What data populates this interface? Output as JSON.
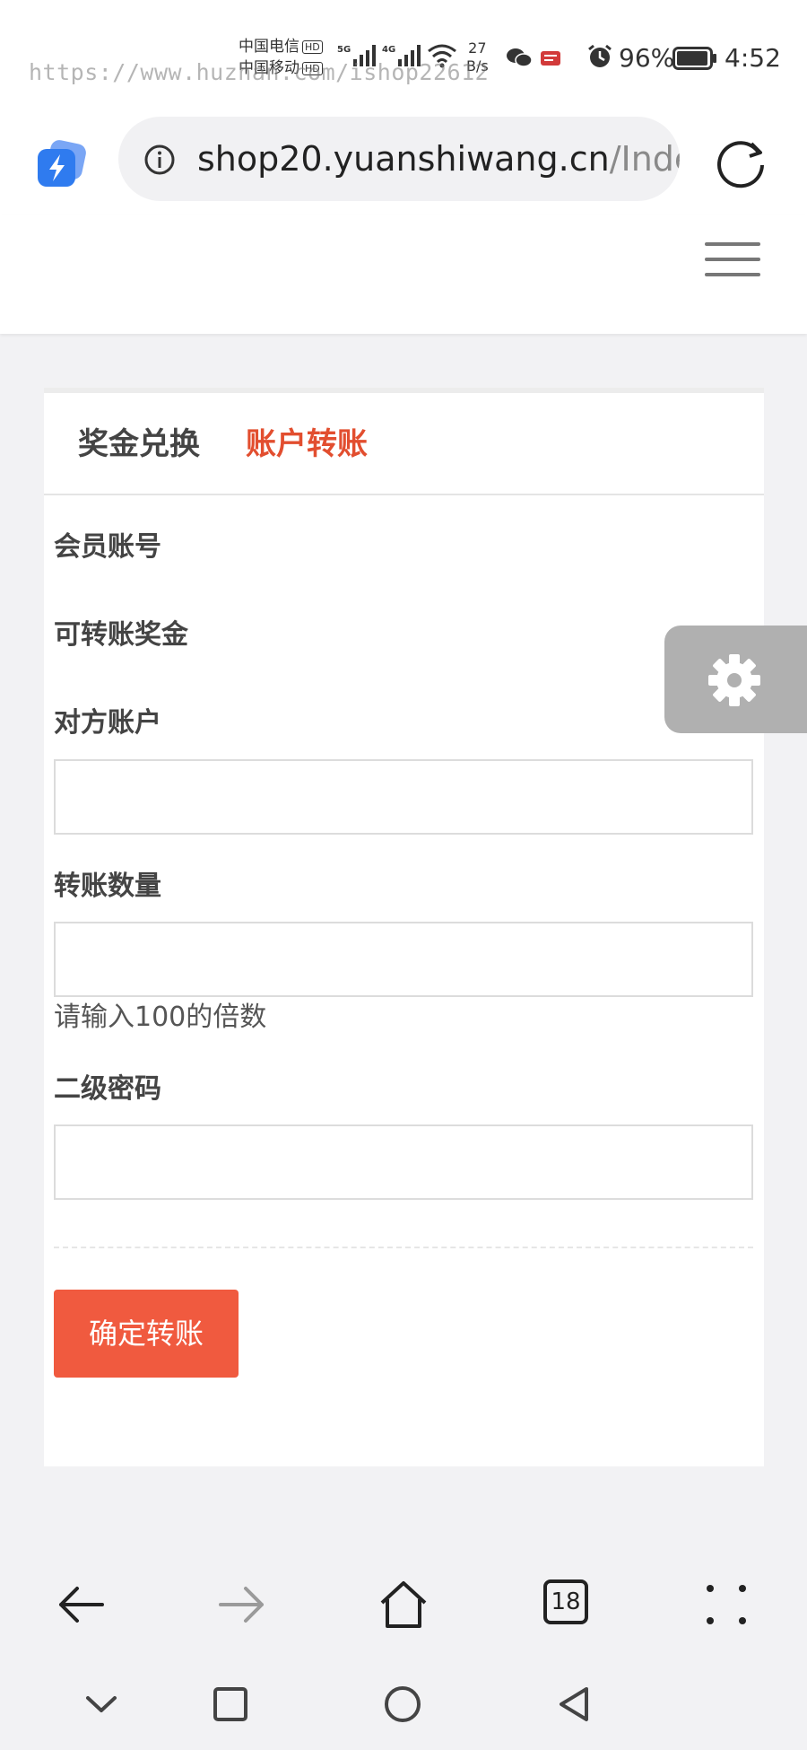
{
  "status_bar": {
    "carrier_1": "中国电信",
    "carrier_2": "中国移动",
    "hd_badge": "HD",
    "signal_1_gen": "5G",
    "signal_2_gen": "4G",
    "net_speed_value": "27",
    "net_speed_unit": "B/s",
    "battery_percent": "96%",
    "time": "4:52",
    "watermark": "https://www.huzhan.com/ishop22612"
  },
  "browser": {
    "url_domain": "shop20.yuanshiwang.cn",
    "url_path": "/Index",
    "tab_count": "18",
    "icons": {
      "app": "lightning-bolt-icon",
      "info": "info-circle-icon",
      "reload": "reload-icon",
      "back": "back-arrow-icon",
      "forward": "forward-arrow-icon",
      "home": "home-icon",
      "menu": "more-dots-icon"
    }
  },
  "site": {
    "menu_icon": "hamburger-menu-icon"
  },
  "tabs": [
    {
      "label": "奖金兑换",
      "active": false
    },
    {
      "label": "账户转账",
      "active": true
    }
  ],
  "form": {
    "member_account_label": "会员账号",
    "transferable_bonus_label": "可转账奖金",
    "target_account_label": "对方账户",
    "target_account_value": "",
    "transfer_amount_label": "转账数量",
    "transfer_amount_value": "",
    "transfer_amount_hint": "请输入100的倍数",
    "secondary_password_label": "二级密码",
    "secondary_password_value": "",
    "submit_label": "确定转账"
  },
  "floating": {
    "settings_icon": "gear-icon"
  },
  "colors": {
    "accent": "#e24e2f",
    "button": "#f05a3f",
    "page_bg": "#f2f2f4",
    "floating_bg": "#b0b0b0"
  }
}
